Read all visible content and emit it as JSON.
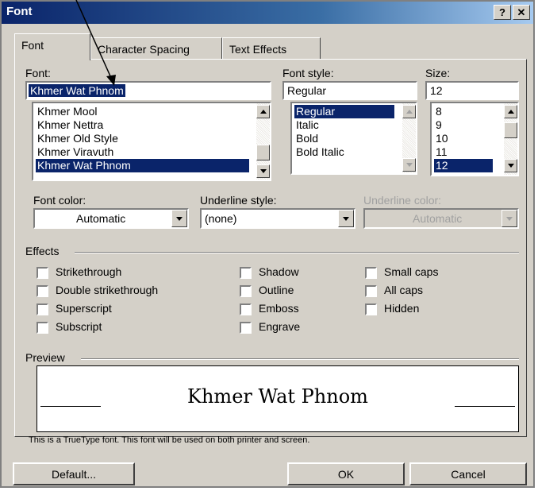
{
  "window": {
    "title": "Font",
    "help_label": "?",
    "close_label": "✕"
  },
  "tabs": [
    {
      "label": "Font",
      "active": true
    },
    {
      "label": "Character Spacing",
      "active": false
    },
    {
      "label": "Text Effects",
      "active": false
    }
  ],
  "font": {
    "label": "Font:",
    "value": "Khmer Wat Phnom",
    "list": [
      "Khmer Mool",
      "Khmer Nettra",
      "Khmer Old Style",
      "Khmer Viravuth",
      "Khmer Wat Phnom"
    ],
    "selected": "Khmer Wat Phnom"
  },
  "font_style": {
    "label": "Font style:",
    "value": "Regular",
    "list": [
      "Regular",
      "Italic",
      "Bold",
      "Bold Italic"
    ],
    "selected": "Regular"
  },
  "size": {
    "label": "Size:",
    "value": "12",
    "list": [
      "8",
      "9",
      "10",
      "11",
      "12"
    ],
    "selected": "12"
  },
  "font_color": {
    "label": "Font color:",
    "value": "Automatic"
  },
  "underline_style": {
    "label": "Underline style:",
    "value": "(none)"
  },
  "underline_color": {
    "label": "Underline color:",
    "value": "Automatic",
    "disabled": true
  },
  "effects": {
    "label": "Effects",
    "col1": [
      "Strikethrough",
      "Double strikethrough",
      "Superscript",
      "Subscript"
    ],
    "col2": [
      "Shadow",
      "Outline",
      "Emboss",
      "Engrave"
    ],
    "col3": [
      "Small caps",
      "All caps",
      "Hidden"
    ]
  },
  "preview": {
    "label": "Preview",
    "sample": "Khmer Wat Phnom",
    "note": "This is a TrueType font. This font will be used on both printer and screen."
  },
  "buttons": {
    "default": "Default...",
    "ok": "OK",
    "cancel": "Cancel"
  },
  "colors": {
    "titlebar": "#0a246a",
    "face": "#d4d0c8",
    "selection": "#0a246a"
  }
}
